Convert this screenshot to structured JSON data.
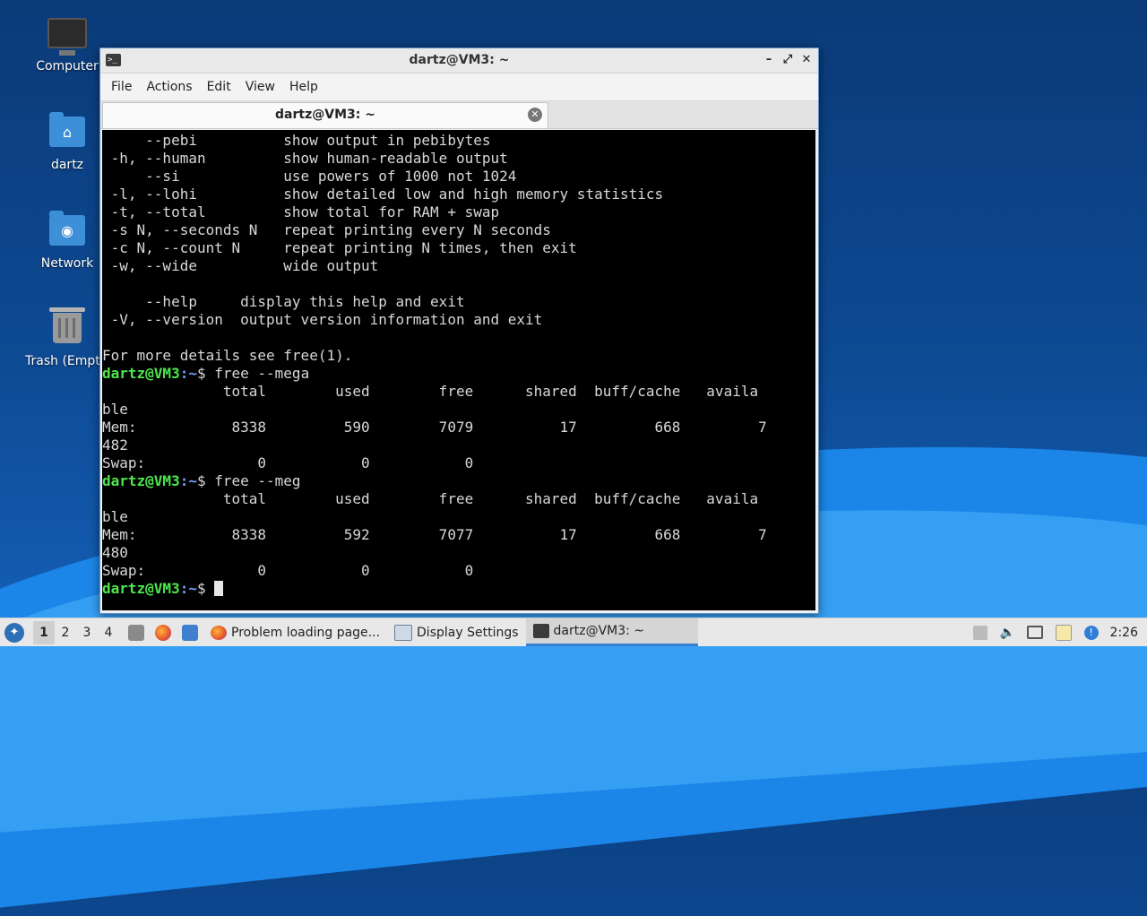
{
  "desktop": {
    "icons": [
      {
        "label": "Computer",
        "icon": "computer-icon"
      },
      {
        "label": "dartz",
        "icon": "home-folder-icon"
      },
      {
        "label": "Network",
        "icon": "network-folder-icon"
      },
      {
        "label": "Trash (Empt",
        "icon": "trash-icon"
      }
    ]
  },
  "window": {
    "title": "dartz@VM3: ~",
    "controls": {
      "minimize": "–",
      "maximize": "⤢",
      "close": "✕"
    },
    "menu": [
      "File",
      "Actions",
      "Edit",
      "View",
      "Help"
    ],
    "tab": {
      "label": "dartz@VM3: ~",
      "close": "✕"
    }
  },
  "terminal": {
    "prompt_user": "dartz@VM3",
    "prompt_path": ":~",
    "prompt_symbol": "$ ",
    "help_lines": [
      "     --pebi          show output in pebibytes",
      " -h, --human         show human-readable output",
      "     --si            use powers of 1000 not 1024",
      " -l, --lohi          show detailed low and high memory statistics",
      " -t, --total         show total for RAM + swap",
      " -s N, --seconds N   repeat printing every N seconds",
      " -c N, --count N     repeat printing N times, then exit",
      " -w, --wide          wide output",
      "",
      "     --help     display this help and exit",
      " -V, --version  output version information and exit",
      "",
      "For more details see free(1)."
    ],
    "cmd1": "free --mega",
    "out1": [
      "              total        used        free      shared  buff/cache   availa",
      "ble",
      "Mem:           8338         590        7079          17         668         7",
      "482",
      "Swap:             0           0           0"
    ],
    "cmd2": "free --meg",
    "out2": [
      "              total        used        free      shared  buff/cache   availa",
      "ble",
      "Mem:           8338         592        7077          17         668         7",
      "480",
      "Swap:             0           0           0"
    ]
  },
  "taskbar": {
    "start_icon": "app-menu-icon",
    "workspaces": [
      "1",
      "2",
      "3",
      "4"
    ],
    "quick_launch": [
      "file-manager-icon",
      "firefox-icon",
      "desktop-icon"
    ],
    "tasks": [
      {
        "label": "Problem loading page...",
        "icon": "firefox-icon"
      },
      {
        "label": "Display Settings",
        "icon": "display-settings-icon"
      },
      {
        "label": "dartz@VM3: ~",
        "icon": "terminal-icon"
      }
    ],
    "tray_icons": [
      "removable-drive-icon",
      "volume-icon",
      "network-icon",
      "clipboard-icon",
      "update-notifier-icon"
    ],
    "clock": "2:26"
  }
}
